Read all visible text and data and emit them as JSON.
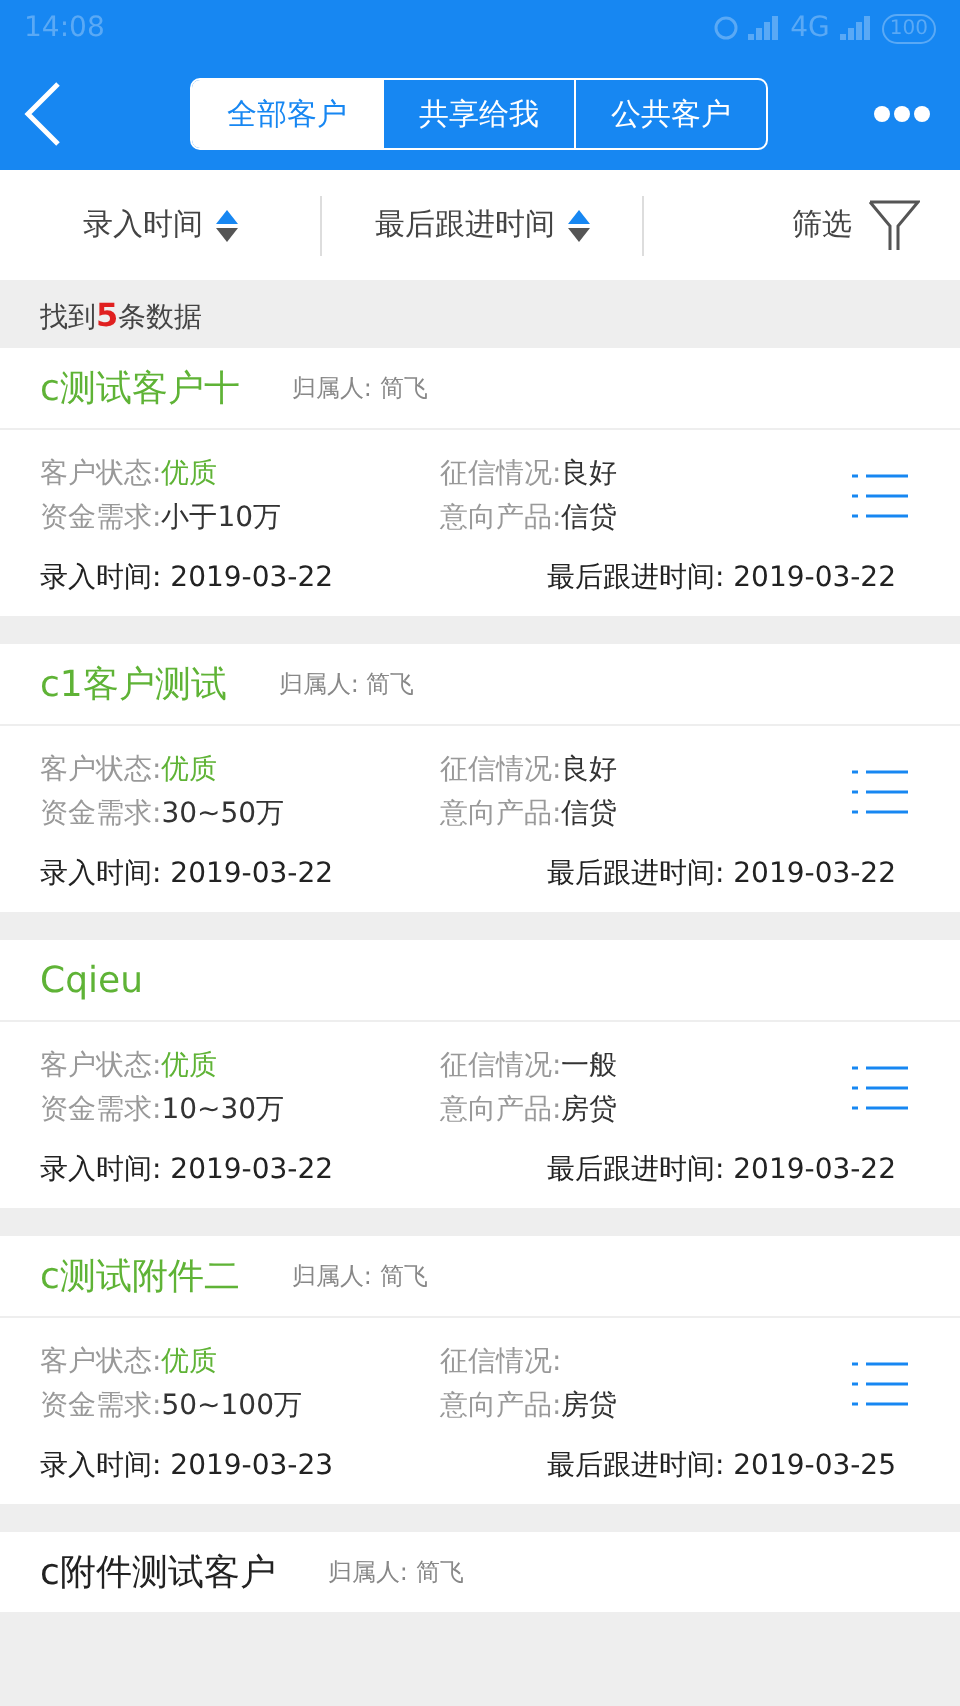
{
  "status_bar": {
    "time": "14:08",
    "network": "4G",
    "battery": "100"
  },
  "header": {
    "tabs": [
      {
        "label": "全部客户",
        "selected": true
      },
      {
        "label": "共享给我",
        "selected": false
      },
      {
        "label": "公共客户",
        "selected": false
      }
    ]
  },
  "sort_bar": {
    "sorts": [
      {
        "label": "录入时间"
      },
      {
        "label": "最后跟进时间"
      }
    ],
    "filter": "筛选"
  },
  "result": {
    "prefix": "找到",
    "count": "5",
    "suffix": "条数据"
  },
  "customers": [
    {
      "name": "c测试客户十",
      "color": "#5fb336",
      "owner_label": "归属人:",
      "owner": "简飞",
      "status_label": "客户状态:",
      "status": "优质",
      "credit_label": "征信情况:",
      "credit": "良好",
      "funds_label": "资金需求:",
      "funds": "小于10万",
      "product_label": "意向产品:",
      "product": "信贷",
      "created_label": "录入时间:",
      "created": "2019-03-22",
      "followed_label": "最后跟进时间:",
      "followed": "2019-03-22"
    },
    {
      "name": "c1客户测试",
      "color": "#5fb336",
      "owner_label": "归属人:",
      "owner": "简飞",
      "status_label": "客户状态:",
      "status": "优质",
      "credit_label": "征信情况:",
      "credit": "良好",
      "funds_label": "资金需求:",
      "funds": "30~50万",
      "product_label": "意向产品:",
      "product": "信贷",
      "created_label": "录入时间:",
      "created": "2019-03-22",
      "followed_label": "最后跟进时间:",
      "followed": "2019-03-22"
    },
    {
      "name": "Cqieu",
      "color": "#5fb336",
      "status_label": "客户状态:",
      "status": "优质",
      "credit_label": "征信情况:",
      "credit": "一般",
      "funds_label": "资金需求:",
      "funds": "10~30万",
      "product_label": "意向产品:",
      "product": "房贷",
      "created_label": "录入时间:",
      "created": "2019-03-22",
      "followed_label": "最后跟进时间:",
      "followed": "2019-03-22"
    },
    {
      "name": "c测试附件二",
      "color": "#5fb336",
      "owner_label": "归属人:",
      "owner": "简飞",
      "status_label": "客户状态:",
      "status": "优质",
      "credit_label": "征信情况:",
      "funds_label": "资金需求:",
      "funds": "50~100万",
      "product_label": "意向产品:",
      "product": "房贷",
      "created_label": "录入时间:",
      "created": "2019-03-23",
      "followed_label": "最后跟进时间:",
      "followed": "2019-03-25"
    },
    {
      "name": "c附件测试客户",
      "color": "#222222",
      "owner_label": "归属人:",
      "owner": "简飞"
    }
  ]
}
